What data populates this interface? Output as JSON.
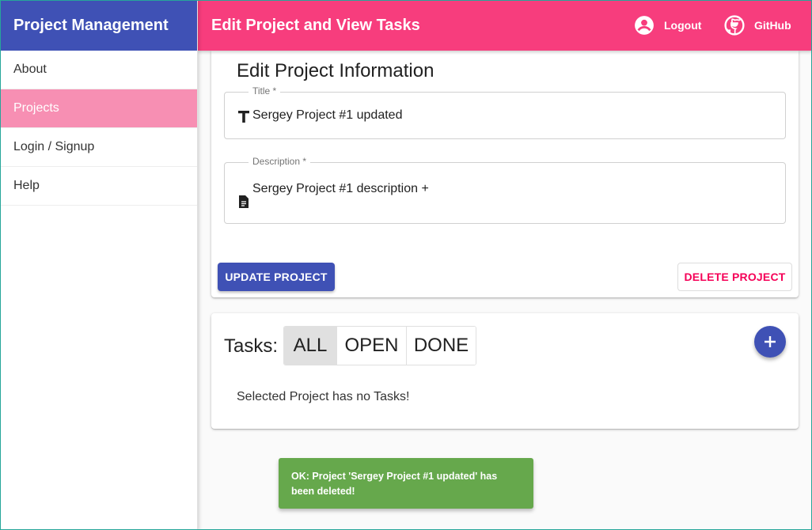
{
  "sidebar": {
    "title": "Project Management",
    "items": [
      {
        "label": "About"
      },
      {
        "label": "Projects"
      },
      {
        "label": "Login / Signup"
      },
      {
        "label": "Help"
      }
    ]
  },
  "appbar": {
    "title": "Edit Project and View Tasks",
    "logout_label": "Logout",
    "github_label": "GitHub"
  },
  "edit_card": {
    "title": "Edit Project Information",
    "title_field": {
      "label": "Title *",
      "value": "Sergey Project #1 updated"
    },
    "description_field": {
      "label": "Description *",
      "value": "Sergey Project #1 description +"
    },
    "update_button": "UPDATE PROJECT",
    "delete_button": "DELETE PROJECT"
  },
  "tasks_card": {
    "label": "Tasks:",
    "filters": [
      "ALL",
      "OPEN",
      "DONE"
    ],
    "selected_filter": "ALL",
    "add_icon": "plus-icon",
    "empty_message": "Selected Project has no Tasks!"
  },
  "snackbar": {
    "message": "OK: Project 'Sergey Project #1 updated' has been deleted!"
  },
  "colors": {
    "primary": "#3f51b5",
    "secondary": "#f73d7d",
    "active_nav": "#f78fb3",
    "delete": "#f50057",
    "success": "#66a84c"
  },
  "icons": {
    "logout": "account-circle-icon",
    "github": "github-icon",
    "title_field": "text-t-icon",
    "description_field": "document-icon"
  }
}
